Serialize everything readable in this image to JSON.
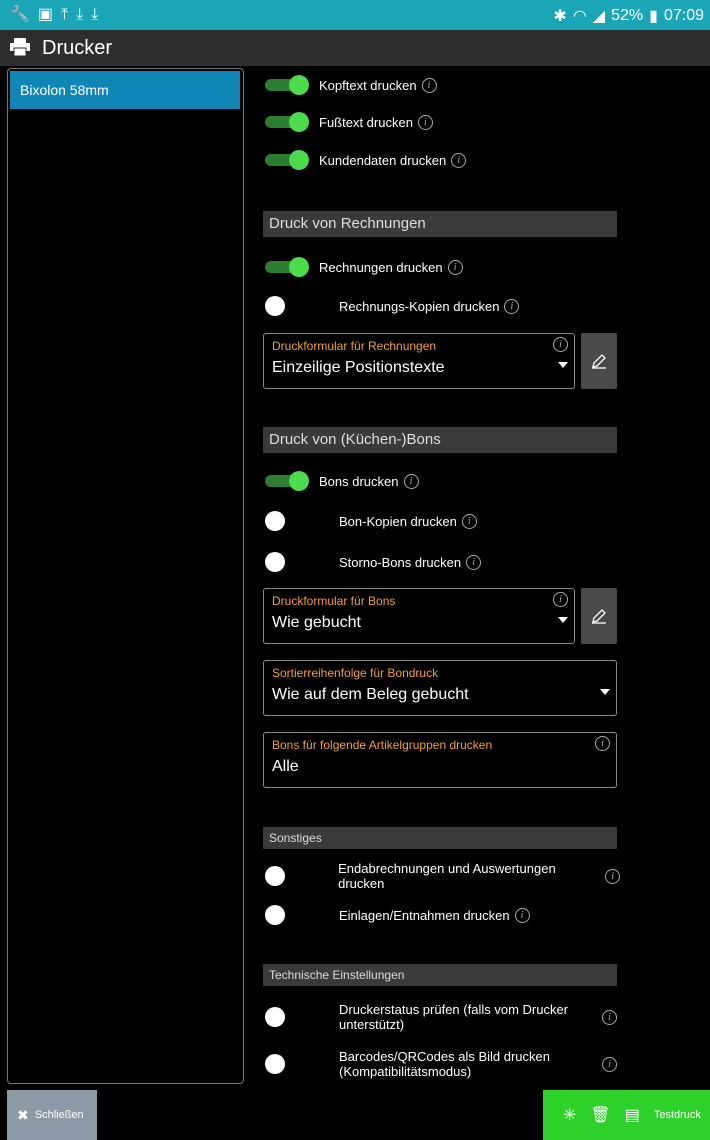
{
  "status_bar": {
    "left_icons": [
      "wrench-icon",
      "image-icon",
      "upload-icon",
      "download-icon",
      "download-icon"
    ],
    "bluetooth_icon": "bluetooth-icon",
    "wifi_icon": "wifi-icon",
    "signal_icon": "signal-icon",
    "battery": "52%",
    "battery_icon": "battery-icon",
    "time": "07:09"
  },
  "app": {
    "title": "Drucker",
    "title_icon": "printer-icon"
  },
  "sidebar": {
    "items": [
      {
        "label": "Bixolon 58mm",
        "selected": true
      }
    ]
  },
  "toggles_top": [
    {
      "label": "Kopftext drucken",
      "on": true
    },
    {
      "label": "Fußtext drucken",
      "on": true
    },
    {
      "label": "Kundendaten drucken",
      "on": true
    }
  ],
  "section_invoices": {
    "title": "Druck von Rechnungen",
    "toggles": [
      {
        "label": "Rechnungen drucken",
        "on": true
      },
      {
        "label": "Rechnungs-Kopien drucken",
        "on": false
      }
    ],
    "form_field": {
      "label": "Druckformular für Rechnungen",
      "value": "Einzeilige Positionstexte"
    }
  },
  "section_bons": {
    "title": "Druck von (Küchen-)Bons",
    "toggles": [
      {
        "label": "Bons drucken",
        "on": true
      },
      {
        "label": "Bon-Kopien drucken",
        "on": false
      },
      {
        "label": "Storno-Bons drucken",
        "on": false
      }
    ],
    "form_field": {
      "label": "Druckformular für Bons",
      "value": "Wie gebucht"
    },
    "sort_field": {
      "label": "Sortierreihenfolge für Bondruck",
      "value": "Wie auf dem Beleg gebucht"
    },
    "groups_field": {
      "label": "Bons für folgende Artikelgruppen drucken",
      "value": "Alle"
    }
  },
  "section_misc": {
    "title": "Sonstiges",
    "toggles": [
      {
        "label": "Endabrechnungen und Auswertungen drucken",
        "on": false
      },
      {
        "label": "Einlagen/Entnahmen drucken",
        "on": false
      }
    ]
  },
  "section_tech": {
    "title": "Technische Einstellungen",
    "toggles": [
      {
        "label": "Druckerstatus prüfen (falls vom Drucker unterstützt)",
        "on": false
      },
      {
        "label": "Barcodes/QRCodes als Bild drucken (Kompatibilitätsmodus)",
        "on": false
      }
    ]
  },
  "bottom_bar": {
    "close_label": "Schließen",
    "test_label": "Testdruck",
    "accent_close": "#8c9aa6",
    "accent_actions": "#2ed02a"
  },
  "colors": {
    "status_bar": "#1aa6b7",
    "selected_item": "#1086b6",
    "toggle_on": "#4cdb4c",
    "field_label": "#f0a030"
  }
}
